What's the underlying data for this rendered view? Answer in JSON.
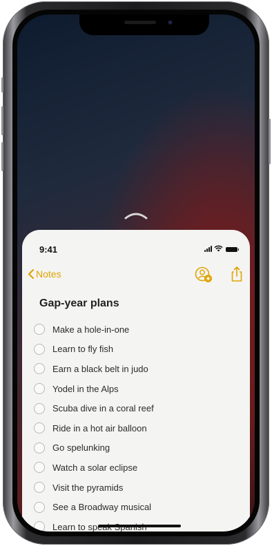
{
  "status_bar": {
    "time": "9:41",
    "signal_icon": "signal-bars-icon",
    "wifi_icon": "wifi-icon",
    "battery_icon": "battery-icon"
  },
  "nav": {
    "back_label": "Notes",
    "back_icon": "chevron-left-icon",
    "collaborate_icon": "add-person-icon",
    "share_icon": "share-icon"
  },
  "note": {
    "title": "Gap-year plans",
    "items": [
      "Make a hole-in-one",
      "Learn to fly fish",
      "Earn a black belt in judo",
      "Yodel in the Alps",
      "Scuba dive in a coral reef",
      "Ride in a hot air balloon",
      "Go spelunking",
      "Watch a solar eclipse",
      "Visit the pyramids",
      "See a Broadway musical",
      "Learn to speak Spanish"
    ]
  },
  "colors": {
    "accent": "#E0A400",
    "sheet_background": "#F4F4F2",
    "wallpaper_dark": "#0E1B2E",
    "wallpaper_red": "#7A1A1A"
  }
}
